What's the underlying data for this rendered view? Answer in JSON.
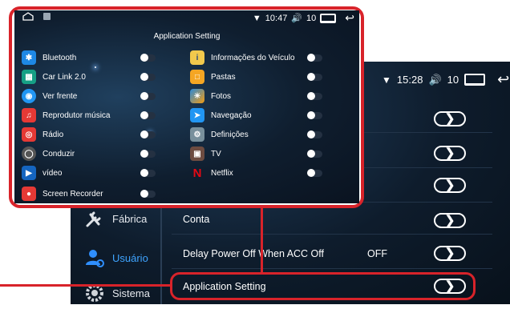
{
  "background_screen": {
    "status": {
      "time": "15:28",
      "volume": "10"
    },
    "sidebar": [
      {
        "label": "Fábrica",
        "icon": "tools-icon",
        "active": false
      },
      {
        "label": "Usuário",
        "icon": "user-settings-icon",
        "active": true
      },
      {
        "label": "Sistema",
        "icon": "system-gear-icon",
        "active": false
      }
    ],
    "rows": [
      {
        "label": "",
        "value": ""
      },
      {
        "label": "",
        "value": ""
      },
      {
        "label": "",
        "value": ""
      },
      {
        "label": "Conta",
        "value": ""
      },
      {
        "label": "Delay Power Off When ACC Off",
        "value": "OFF"
      },
      {
        "label": "Application Setting",
        "value": ""
      }
    ]
  },
  "popup_screen": {
    "status": {
      "time": "10:47",
      "volume": "10"
    },
    "title": "Application Setting",
    "left_items": [
      {
        "label": "Bluetooth",
        "icon": "bluetooth-icon",
        "color": "#1e88e5"
      },
      {
        "label": "Car Link 2.0",
        "icon": "carlink-icon",
        "color": "#16a085"
      },
      {
        "label": "Ver frente",
        "icon": "camera-icon",
        "color": "#2196f3"
      },
      {
        "label": "Reprodutor música",
        "icon": "music-icon",
        "color": "#e53935"
      },
      {
        "label": "Rádio",
        "icon": "radio-icon",
        "color": "#e53935"
      },
      {
        "label": "Conduzir",
        "icon": "drive-icon",
        "color": "#555555"
      },
      {
        "label": "vídeo",
        "icon": "video-icon",
        "color": "#1565c0"
      },
      {
        "label": "Screen Recorder",
        "icon": "record-icon",
        "color": "#e53935"
      }
    ],
    "right_items": [
      {
        "label": "Informações do Veículo",
        "icon": "vehicle-info-icon",
        "color": "#f2c94c"
      },
      {
        "label": "Pastas",
        "icon": "folder-icon",
        "color": "#f5a623"
      },
      {
        "label": "Fotos",
        "icon": "photos-icon",
        "color": "#f39c12"
      },
      {
        "label": "Navegação",
        "icon": "navigation-icon",
        "color": "#2196f3"
      },
      {
        "label": "Definições",
        "icon": "settings-icon",
        "color": "#78909c"
      },
      {
        "label": "TV",
        "icon": "tv-icon",
        "color": "#6d4c41"
      },
      {
        "label": "Netflix",
        "icon": "netflix-icon",
        "color": "#e50914"
      }
    ]
  },
  "colors": {
    "highlight": "#d8232a",
    "active_text": "#3fa4ff"
  }
}
